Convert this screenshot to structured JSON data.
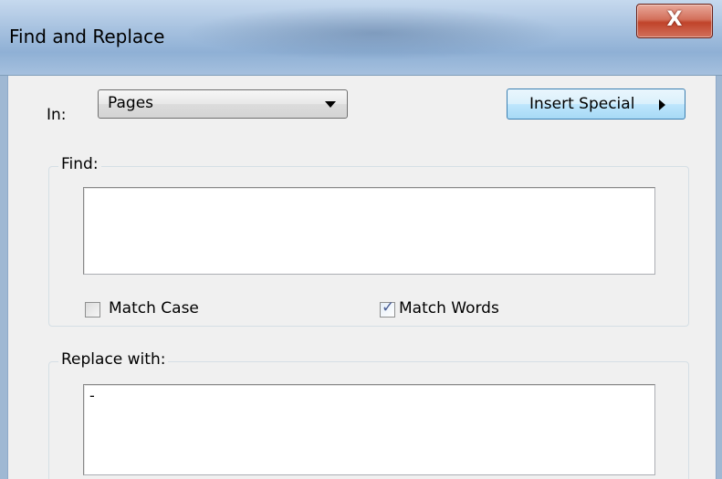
{
  "window": {
    "title": "Find and Replace",
    "close_glyph": "X"
  },
  "scope": {
    "label": "In:",
    "selected": "Pages"
  },
  "insert_special": {
    "label": "Insert Special"
  },
  "find": {
    "group_label": "Find:",
    "value": "",
    "match_case": {
      "label": "Match Case",
      "checked": false
    },
    "match_words": {
      "label": "Match Words",
      "checked": true,
      "check_glyph": "✓"
    }
  },
  "replace": {
    "group_label": "Replace with:",
    "value": "-"
  }
}
